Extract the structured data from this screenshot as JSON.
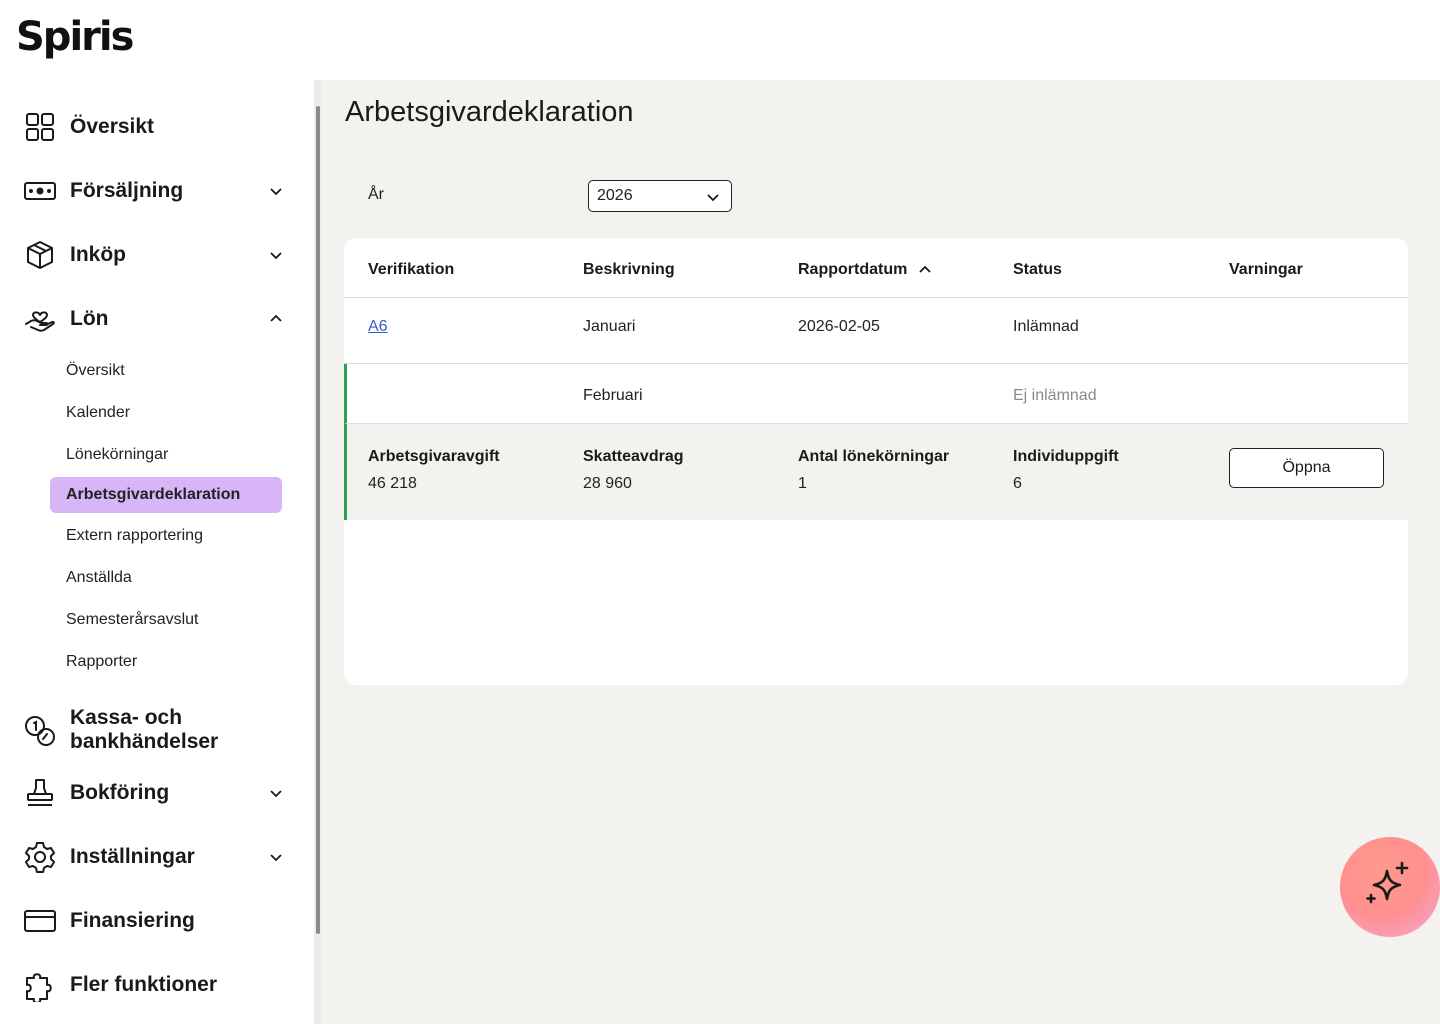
{
  "brand": {
    "logo": "Spiris"
  },
  "sidebar": {
    "items": [
      {
        "label": "Översikt",
        "icon": "grid-icon",
        "expandable": false
      },
      {
        "label": "Försäljning",
        "icon": "cash-icon",
        "expandable": true,
        "expanded": false
      },
      {
        "label": "Inköp",
        "icon": "box-icon",
        "expandable": true,
        "expanded": false
      },
      {
        "label": "Lön",
        "icon": "hand-heart-icon",
        "expandable": true,
        "expanded": true
      },
      {
        "label": "Kassa- och bankhändelser",
        "icon": "coins-icon",
        "expandable": false
      },
      {
        "label": "Bokföring",
        "icon": "stamp-icon",
        "expandable": true,
        "expanded": false
      },
      {
        "label": "Inställningar",
        "icon": "gear-icon",
        "expandable": true,
        "expanded": false
      },
      {
        "label": "Finansiering",
        "icon": "card-icon",
        "expandable": false
      },
      {
        "label": "Fler funktioner",
        "icon": "puzzle-icon",
        "expandable": false
      }
    ],
    "lon_sub": [
      {
        "label": "Översikt"
      },
      {
        "label": "Kalender"
      },
      {
        "label": "Lönekörningar"
      },
      {
        "label": "Arbetsgivardeklaration",
        "active": true
      },
      {
        "label": "Extern rapportering"
      },
      {
        "label": "Anställda"
      },
      {
        "label": "Semesterårsavslut"
      },
      {
        "label": "Rapporter"
      }
    ]
  },
  "main": {
    "title": "Arbetsgivardeklaration",
    "year_label": "År",
    "year_value": "2026",
    "table": {
      "headers": [
        "Verifikation",
        "Beskrivning",
        "Rapportdatum",
        "Status",
        "Varningar"
      ],
      "sort_column": "Rapportdatum",
      "sort_direction": "ascending",
      "rows": [
        {
          "verifikation": "A6",
          "beskrivning": "Januari",
          "rapportdatum": "2026-02-05",
          "status": "Inlämnad",
          "varningar": ""
        },
        {
          "verifikation": "",
          "beskrivning": "Februari",
          "rapportdatum": "",
          "status": "Ej inlämnad",
          "varningar": ""
        }
      ],
      "expanded_details": {
        "fields": [
          {
            "label": "Arbetsgivaravgift",
            "value": "46 218"
          },
          {
            "label": "Skatteavdrag",
            "value": "28 960"
          },
          {
            "label": "Antal lönekörningar",
            "value": "1"
          },
          {
            "label": "Individuppgift",
            "value": "6"
          }
        ],
        "action_label": "Öppna"
      }
    }
  },
  "colors": {
    "active_nav": "#d7b5f7",
    "expanded_row_accent": "#2e9e4f",
    "link": "#3b5bc4",
    "main_background": "#f3f2ef"
  },
  "fab": {
    "icon": "sparkle-icon"
  }
}
